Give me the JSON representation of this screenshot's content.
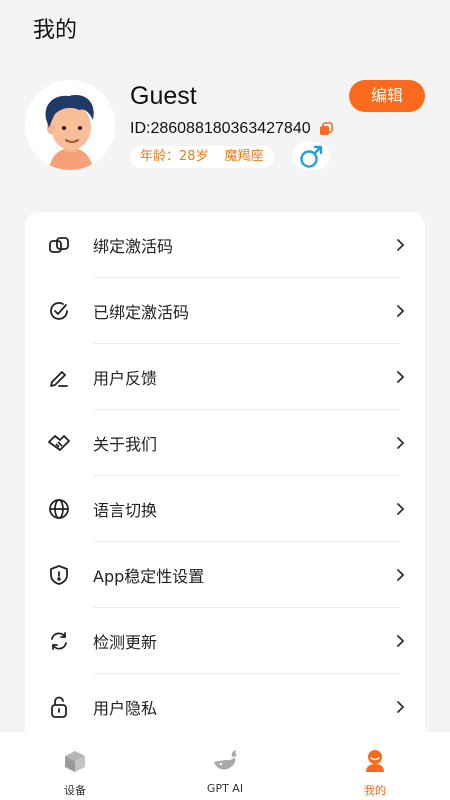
{
  "header": {
    "title": "我的"
  },
  "profile": {
    "name": "Guest",
    "id_text": "ID:286088180363427840",
    "age_text": "年龄：28岁",
    "zodiac": "魔羯座",
    "edit_label": "编辑",
    "gender_icon": "male-icon"
  },
  "menu": {
    "items": [
      {
        "label": "绑定激活码",
        "icon": "link-icon"
      },
      {
        "label": "已绑定激活码",
        "icon": "check-circle-icon"
      },
      {
        "label": "用户反馈",
        "icon": "pencil-icon"
      },
      {
        "label": "关于我们",
        "icon": "handshake-icon"
      },
      {
        "label": "语言切换",
        "icon": "globe-icon"
      },
      {
        "label": "App稳定性设置",
        "icon": "shield-icon"
      },
      {
        "label": "检测更新",
        "icon": "refresh-icon"
      },
      {
        "label": "用户隐私",
        "icon": "lock-icon"
      }
    ]
  },
  "tabbar": {
    "tabs": [
      {
        "label": "设备",
        "icon": "box-icon"
      },
      {
        "label": "GPT AI",
        "icon": "whale-icon"
      },
      {
        "label": "我的",
        "icon": "person-icon",
        "active": true
      }
    ]
  },
  "colors": {
    "accent": "#fb6a1c",
    "tag_text": "#f57a16",
    "male_blue": "#1ea0e0"
  }
}
